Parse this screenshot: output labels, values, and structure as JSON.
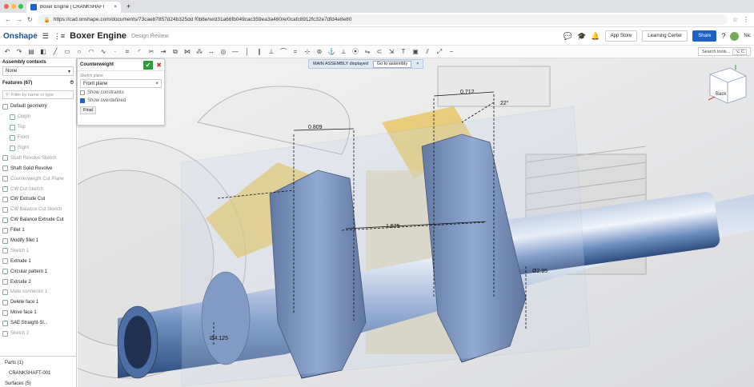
{
  "browser": {
    "tab_title": "Boxer Engine | CRANKSHAFT",
    "url": "https://cad.onshape.com/documents/73caeb7857d24b325dd f0b8e/w/d31a66fb049cac359ea3a460/e/0cafc8912fc32e7dfd4e8e80"
  },
  "app": {
    "logo": "Onshape",
    "doc_title": "Boxer Engine",
    "doc_subtitle": "Design Review",
    "app_store": "App Store",
    "learning_center": "Learning Center",
    "share": "Share",
    "user": "Nic"
  },
  "toolbar": {
    "search_placeholder": "Search tools...",
    "search_shortcut": "⌥ C"
  },
  "sidebar": {
    "assembly_header": "Assembly contexts",
    "assembly_value": "None",
    "features_header": "Features (67)",
    "filter_placeholder": "Filter by name or type",
    "features": [
      {
        "label": "Default geometry",
        "dim": false
      },
      {
        "label": "Origin",
        "dim": true
      },
      {
        "label": "Top",
        "dim": true
      },
      {
        "label": "Front",
        "dim": true
      },
      {
        "label": "Right",
        "dim": true
      },
      {
        "label": "Shaft Revolve Sketch",
        "dim": true
      },
      {
        "label": "Shaft Solid Revolve",
        "dim": false
      },
      {
        "label": "Counterweight Cut Plane",
        "dim": true
      },
      {
        "label": "CW Cut Sketch",
        "dim": true
      },
      {
        "label": "CW Extrude Cut",
        "dim": false
      },
      {
        "label": "CW Balance Cut Sketch",
        "dim": true
      },
      {
        "label": "CW Balance Extrude Cut",
        "dim": false
      },
      {
        "label": "Fillet 1",
        "dim": false
      },
      {
        "label": "Modify fillet 1",
        "dim": false
      },
      {
        "label": "Sketch 1",
        "dim": true
      },
      {
        "label": "Extrude 1",
        "dim": false
      },
      {
        "label": "Circular pattern 1",
        "dim": false
      },
      {
        "label": "Extrude 2",
        "dim": false
      },
      {
        "label": "Mate connector 1",
        "dim": true
      },
      {
        "label": "Delete face 1",
        "dim": false
      },
      {
        "label": "Move face 1",
        "dim": false
      },
      {
        "label": "SAE Straight-Sl...",
        "dim": false
      },
      {
        "label": "Sketch 2",
        "dim": true
      }
    ],
    "parts_header": "Parts (1)",
    "part_name": "CRANKSHAFT-001",
    "surfaces_header": "Surfaces (5)"
  },
  "panel": {
    "title": "Counterweight",
    "sketch_plane_label": "Sketch plane",
    "sketch_plane_value": "Front plane",
    "show_constraints": "Show constraints",
    "show_overdefined": "Show overdefined",
    "final_button": "Final"
  },
  "banner": {
    "text": "MAIN ASSEMBLY displayed",
    "button": "Go to assembly"
  },
  "viewcube": {
    "face": "Back"
  },
  "dimensions": {
    "d1": "0.809",
    "d2": "0.712",
    "angle": "22°",
    "d3": "1.575",
    "d4": "Ø2.95",
    "d5": "Ø4.125"
  },
  "colors": {
    "brand": "#1e62c8",
    "part": "#4d6fa8",
    "highlight": "#e7c24d"
  }
}
